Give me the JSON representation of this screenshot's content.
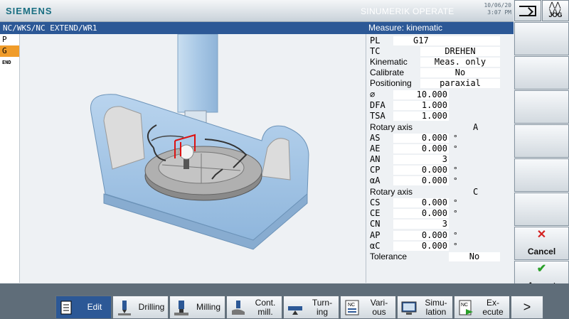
{
  "header": {
    "brand": "SIEMENS",
    "product": "SINUMERIK OPERATE",
    "date": "10/06/20",
    "time": "3:07 PM",
    "jog_label": "JOG"
  },
  "program_path": "NC/WKS/NC EXTEND/WR1",
  "form_title": "Measure: kinematic",
  "modes": [
    "P",
    "G",
    "END"
  ],
  "form": {
    "pl": {
      "label": "PL",
      "value": "G17"
    },
    "tc": {
      "label": "TC",
      "value": "DREHEN"
    },
    "kinematic": {
      "label": "Kinematic",
      "value": "Meas. only"
    },
    "calibrate": {
      "label": "Calibrate",
      "value": "No"
    },
    "positioning": {
      "label": "Positioning",
      "value": "paraxial"
    },
    "diameter": {
      "label": "⌀",
      "value": "10.000"
    },
    "dfa": {
      "label": "DFA",
      "value": "1.000"
    },
    "tsa": {
      "label": "TSA",
      "value": "1.000"
    },
    "rotary1": {
      "label": "Rotary axis",
      "axis": "A"
    },
    "as": {
      "label": "AS",
      "value": "0.000",
      "unit": "°"
    },
    "ae": {
      "label": "AE",
      "value": "0.000",
      "unit": "°"
    },
    "an": {
      "label": "AN",
      "value": "3"
    },
    "cp": {
      "label": "CP",
      "value": "0.000",
      "unit": "°"
    },
    "aa": {
      "label": "αA",
      "value": "0.000",
      "unit": "°"
    },
    "rotary2": {
      "label": "Rotary axis",
      "axis": "C"
    },
    "cs": {
      "label": "CS",
      "value": "0.000",
      "unit": "°"
    },
    "ce": {
      "label": "CE",
      "value": "0.000",
      "unit": "°"
    },
    "cn": {
      "label": "CN",
      "value": "3"
    },
    "ap": {
      "label": "AP",
      "value": "0.000",
      "unit": "°"
    },
    "ac": {
      "label": "αC",
      "value": "0.000",
      "unit": "°"
    },
    "tolerance": {
      "label": "Tolerance",
      "value": "No"
    }
  },
  "vertical_softkeys": {
    "cancel": "Cancel",
    "accept": "Accept"
  },
  "horizontal_softkeys": [
    {
      "label": "Edit",
      "icon": "edit-icon"
    },
    {
      "label": "Drilling",
      "icon": "drilling-icon"
    },
    {
      "label": "Milling",
      "icon": "milling-icon"
    },
    {
      "label": "Cont.\nmill.",
      "icon": "contour-milling-icon"
    },
    {
      "label": "Turn-\ning",
      "icon": "turning-icon"
    },
    {
      "label": "Vari-\nous",
      "icon": "various-icon"
    },
    {
      "label": "Simu-\nlation",
      "icon": "simulation-icon"
    },
    {
      "label": "Ex-\necute",
      "icon": "execute-icon"
    },
    {
      "label": ">",
      "icon": "next-icon"
    }
  ],
  "nc_badge": "NC",
  "colors": {
    "title_bar": "#2c5896",
    "active_mode": "#f09c2a",
    "cancel": "#d42020",
    "accept": "#2aa02a",
    "machine_body": "#9fc3e6"
  }
}
